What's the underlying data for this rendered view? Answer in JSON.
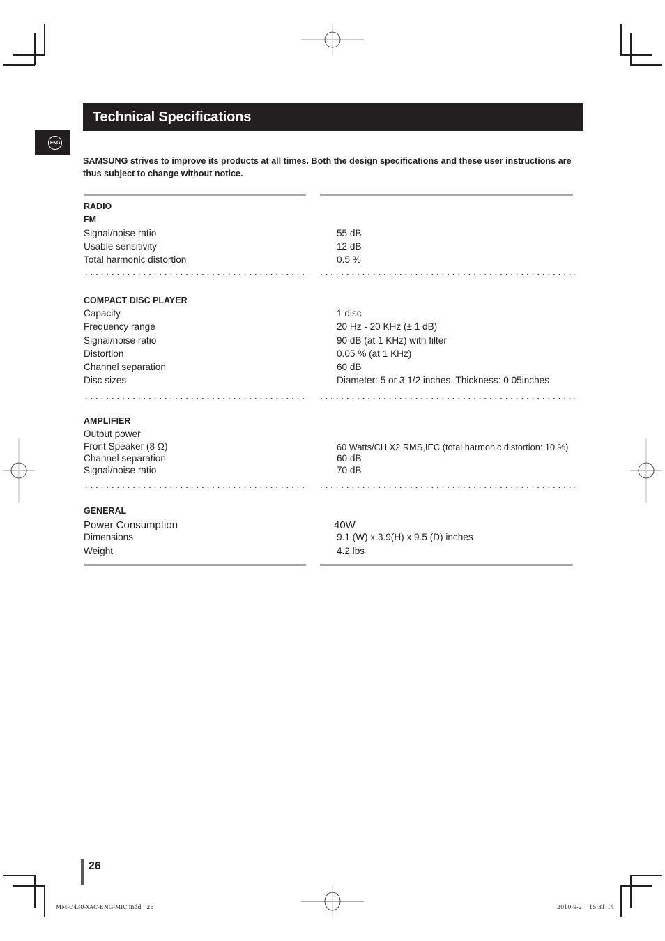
{
  "header": {
    "title": "Technical Specifications",
    "language_badge": "ENG"
  },
  "notice": "SAMSUNG strives to improve its products at all times. Both the design specifications and these user instructions are thus subject to change without notice.",
  "sections": {
    "radio": {
      "heading": "RADIO",
      "subheading": "FM",
      "rows": [
        {
          "label": "Signal/noise ratio",
          "value": "55 dB"
        },
        {
          "label": "Usable sensitivity",
          "value": "12 dB"
        },
        {
          "label": "Total harmonic distortion",
          "value": "0.5 %"
        }
      ]
    },
    "cd": {
      "heading": "COMPACT DISC PLAYER",
      "rows": [
        {
          "label": "Capacity",
          "value": "1 disc"
        },
        {
          "label": "Frequency range",
          "value": "20 Hz - 20 KHz (± 1 dB)"
        },
        {
          "label": "Signal/noise ratio",
          "value": "90 dB (at 1 KHz) with filter"
        },
        {
          "label": "Distortion",
          "value": "0.05 % (at 1 KHz)"
        },
        {
          "label": "Channel separation",
          "value": "60 dB"
        },
        {
          "label": "Disc sizes",
          "value": "Diameter: 5 or 3 1/2 inches. Thickness: 0.05inches"
        }
      ]
    },
    "amplifier": {
      "heading": "AMPLIFIER",
      "rows": [
        {
          "label": "Output power",
          "value": ""
        },
        {
          "label": "Front Speaker (8 Ω)",
          "value": "60 Watts/CH X2 RMS,IEC (total harmonic distortion: 10 %)"
        },
        {
          "label": "Channel separation",
          "value": "60 dB"
        },
        {
          "label": "Signal/noise ratio",
          "value": "70 dB"
        }
      ]
    },
    "general": {
      "heading": "GENERAL",
      "rows": [
        {
          "label": "Power Consumption",
          "value": "40W"
        },
        {
          "label": "Dimensions",
          "value": "9.1 (W) x 3.9(H) x 9.5 (D) inches"
        },
        {
          "label": "Weight",
          "value": "4.2 lbs"
        }
      ]
    }
  },
  "footer": {
    "page_number": "26",
    "file_slug": "MM-C430-XAC-ENG-MIC.indd   26",
    "date_slug": "2010-9-2    15:31:14"
  },
  "colors": {
    "ink": "#231f20",
    "rule_gray": "#a7a9ac",
    "page_bar": "#58595b"
  }
}
